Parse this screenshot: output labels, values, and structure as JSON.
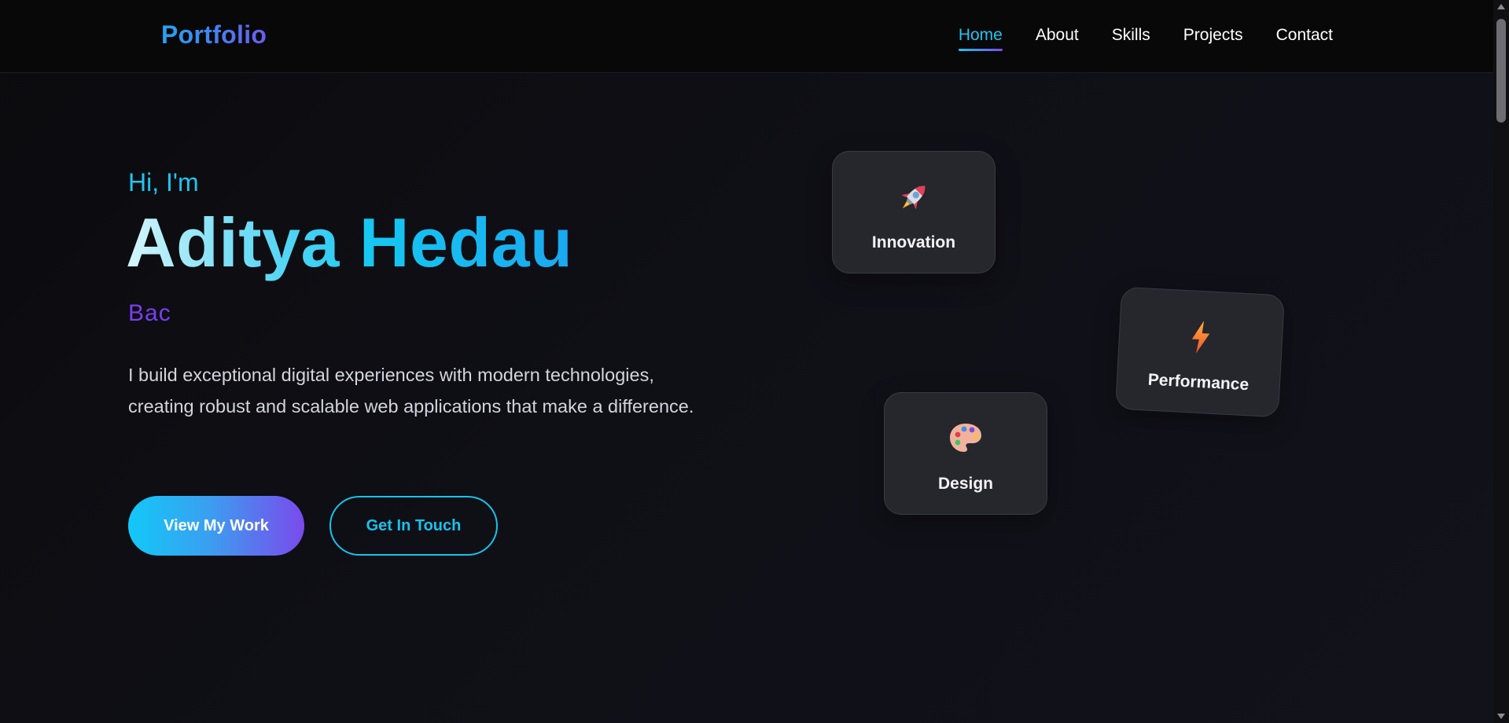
{
  "brand": {
    "logo_text": "Portfolio"
  },
  "nav": {
    "items": [
      {
        "label": "Home",
        "active": true
      },
      {
        "label": "About",
        "active": false
      },
      {
        "label": "Skills",
        "active": false
      },
      {
        "label": "Projects",
        "active": false
      },
      {
        "label": "Contact",
        "active": false
      }
    ]
  },
  "hero": {
    "greeting": "Hi, I'm",
    "name": "Aditya Hedau",
    "role": "Bac",
    "description": "I build exceptional digital experiences with modern technologies, creating robust and scalable web applications that make a difference.",
    "primary_button": "View My Work",
    "secondary_button": "Get In Touch"
  },
  "feature_cards": [
    {
      "label": "Innovation",
      "icon": "rocket-icon"
    },
    {
      "label": "Performance",
      "icon": "lightning-icon"
    },
    {
      "label": "Design",
      "icon": "palette-icon"
    }
  ],
  "colors": {
    "accent_cyan": "#1fc5f0",
    "accent_purple": "#7a3ef0",
    "background": "#0c0c10",
    "card_background": "#26262d"
  }
}
